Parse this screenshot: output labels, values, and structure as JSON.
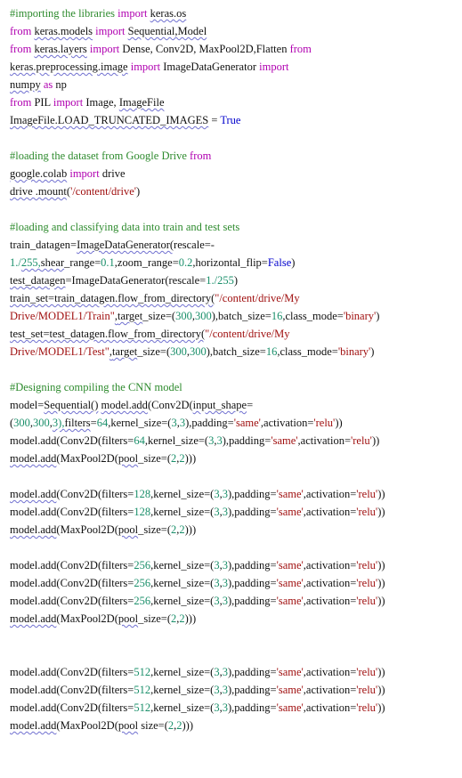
{
  "code_lines": [
    [
      {
        "t": "#importing the libraries ",
        "c": "c"
      },
      {
        "t": "import",
        "c": "k"
      },
      {
        "t": " "
      },
      {
        "t": "keras.os",
        "u": true
      }
    ],
    [
      {
        "t": "from",
        "c": "k"
      },
      {
        "t": " "
      },
      {
        "t": "keras.models",
        "u": true
      },
      {
        "t": " "
      },
      {
        "t": "import",
        "c": "k"
      },
      {
        "t": " "
      },
      {
        "t": "Sequential,Model",
        "u": true
      }
    ],
    [
      {
        "t": "from",
        "c": "k"
      },
      {
        "t": " "
      },
      {
        "t": "keras.layers",
        "u": true
      },
      {
        "t": " "
      },
      {
        "t": "import",
        "c": "k"
      },
      {
        "t": " Dense, Conv2D, MaxPool2D,Flatten "
      },
      {
        "t": "from",
        "c": "k"
      }
    ],
    [
      {
        "t": "keras.preprocessing.image",
        "u": true
      },
      {
        "t": " "
      },
      {
        "t": "import",
        "c": "k"
      },
      {
        "t": " ImageDataGenerator "
      },
      {
        "t": "import",
        "c": "k"
      }
    ],
    [
      {
        "t": "numpy",
        "u": true
      },
      {
        "t": " "
      },
      {
        "t": "as",
        "c": "k"
      },
      {
        "t": " np"
      }
    ],
    [
      {
        "t": "from",
        "c": "k"
      },
      {
        "t": " PIL "
      },
      {
        "t": "import",
        "c": "k"
      },
      {
        "t": " Image, "
      },
      {
        "t": "ImageFile",
        "u": true
      }
    ],
    [
      {
        "t": "ImageFile.LOAD_TRUNCATED_IMAGES",
        "u": true
      },
      {
        "t": " = "
      },
      {
        "t": "True",
        "c": "b"
      }
    ],
    null,
    [
      {
        "t": "#loading the dataset from Google Drive ",
        "c": "c"
      },
      {
        "t": "from",
        "c": "k"
      }
    ],
    [
      {
        "t": "google.colab",
        "u": true
      },
      {
        "t": " "
      },
      {
        "t": "import",
        "c": "k"
      },
      {
        "t": " drive"
      }
    ],
    [
      {
        "t": "drive .mount",
        "u": true
      },
      {
        "t": "("
      },
      {
        "t": "'/content/drive'",
        "c": "s"
      },
      {
        "t": ")"
      }
    ],
    null,
    [
      {
        "t": "#loading and classifying data into train and test sets",
        "c": "c"
      }
    ],
    [
      {
        "t": "train_datagen="
      },
      {
        "t": "ImageDataGenerator(",
        "u": true
      },
      {
        "t": "rescale=-"
      }
    ],
    [
      {
        "t": "1./",
        "c": "n"
      },
      {
        "t": "255,",
        "c": "n",
        "u": true
      },
      {
        "t": "shear",
        "u": true
      },
      {
        "t": "_range="
      },
      {
        "t": "0.1",
        "c": "n"
      },
      {
        "t": ",zoom_range="
      },
      {
        "t": "0.2",
        "c": "n"
      },
      {
        "t": ",horizontal_flip="
      },
      {
        "t": "False",
        "c": "b"
      },
      {
        "t": ")"
      }
    ],
    [
      {
        "t": "test_datagen",
        "u": true
      },
      {
        "t": "=ImageDataGenerator(rescale="
      },
      {
        "t": "1./255",
        "c": "n"
      },
      {
        "t": ")"
      }
    ],
    [
      {
        "t": "train_set=train_datagen.flow_from_directory(",
        "u": true
      },
      {
        "t": "\"/content/drive/My",
        "c": "s"
      }
    ],
    [
      {
        "t": "Drive/MODEL1/Train\"",
        "c": "s"
      },
      {
        "t": ",",
        "u": true
      },
      {
        "t": "target",
        "u": true
      },
      {
        "t": "_size=("
      },
      {
        "t": "300",
        "c": "n"
      },
      {
        "t": ","
      },
      {
        "t": "300",
        "c": "n"
      },
      {
        "t": "),batch_size="
      },
      {
        "t": "16",
        "c": "n"
      },
      {
        "t": ",class_mode="
      },
      {
        "t": "'binary'",
        "c": "s"
      },
      {
        "t": ")"
      }
    ],
    [
      {
        "t": "test_set=test_datagen.flow_from_directory(",
        "u": true
      },
      {
        "t": "\"/content/drive/My",
        "c": "s"
      }
    ],
    [
      {
        "t": "Drive/MODEL1/Test\"",
        "c": "s"
      },
      {
        "t": ",",
        "u": true
      },
      {
        "t": "target",
        "u": true
      },
      {
        "t": "_size=("
      },
      {
        "t": "300",
        "c": "n"
      },
      {
        "t": ","
      },
      {
        "t": "300",
        "c": "n"
      },
      {
        "t": "),batch_size="
      },
      {
        "t": "16",
        "c": "n"
      },
      {
        "t": ",class_mode="
      },
      {
        "t": "'binary'",
        "c": "s"
      },
      {
        "t": ")"
      }
    ],
    null,
    [
      {
        "t": "#Designing compiling the CNN model",
        "c": "c"
      }
    ],
    [
      {
        "t": "model="
      },
      {
        "t": "Sequential()",
        "u": true
      },
      {
        "t": " "
      },
      {
        "t": "model.add",
        "u": true
      },
      {
        "t": "(Conv2D("
      },
      {
        "t": "input_shape",
        "u": true
      },
      {
        "t": "="
      }
    ],
    [
      {
        "t": "("
      },
      {
        "t": "300",
        "c": "n"
      },
      {
        "t": ","
      },
      {
        "t": "300",
        "c": "n"
      },
      {
        "t": ","
      },
      {
        "t": "3),",
        "c": "n",
        "u": true
      },
      {
        "t": "filters",
        "u": true
      },
      {
        "t": "="
      },
      {
        "t": "64",
        "c": "n"
      },
      {
        "t": ",kernel_size=("
      },
      {
        "t": "3",
        "c": "n"
      },
      {
        "t": ","
      },
      {
        "t": "3",
        "c": "n"
      },
      {
        "t": "),padding="
      },
      {
        "t": "'same'",
        "c": "s"
      },
      {
        "t": ",activation="
      },
      {
        "t": "'relu'",
        "c": "s"
      },
      {
        "t": "))"
      }
    ],
    [
      {
        "t": "model.add(Conv2D(filters="
      },
      {
        "t": "64",
        "c": "n"
      },
      {
        "t": ",kernel_size=("
      },
      {
        "t": "3",
        "c": "n"
      },
      {
        "t": ","
      },
      {
        "t": "3",
        "c": "n"
      },
      {
        "t": "),padding="
      },
      {
        "t": "'same'",
        "c": "s"
      },
      {
        "t": ",activation="
      },
      {
        "t": "'relu'",
        "c": "s"
      },
      {
        "t": "))"
      }
    ],
    [
      {
        "t": "model.add",
        "u": true
      },
      {
        "t": "(MaxPool2D("
      },
      {
        "t": "pool",
        "u": true
      },
      {
        "t": "_size=("
      },
      {
        "t": "2",
        "c": "n"
      },
      {
        "t": ","
      },
      {
        "t": "2",
        "c": "n"
      },
      {
        "t": ")))"
      }
    ],
    null,
    [
      {
        "t": "model.add",
        "u": true
      },
      {
        "t": "(Conv2D(filters="
      },
      {
        "t": "128",
        "c": "n"
      },
      {
        "t": ",kernel_size=("
      },
      {
        "t": "3",
        "c": "n"
      },
      {
        "t": ","
      },
      {
        "t": "3",
        "c": "n"
      },
      {
        "t": "),padding="
      },
      {
        "t": "'same'",
        "c": "s"
      },
      {
        "t": ",activation="
      },
      {
        "t": "'relu'",
        "c": "s"
      },
      {
        "t": "))"
      }
    ],
    [
      {
        "t": "model.add(Conv2D(filters="
      },
      {
        "t": "128",
        "c": "n"
      },
      {
        "t": ",kernel_size=("
      },
      {
        "t": "3",
        "c": "n"
      },
      {
        "t": ","
      },
      {
        "t": "3",
        "c": "n"
      },
      {
        "t": "),padding="
      },
      {
        "t": "'same'",
        "c": "s"
      },
      {
        "t": ",activation="
      },
      {
        "t": "'relu'",
        "c": "s"
      },
      {
        "t": "))"
      }
    ],
    [
      {
        "t": "model.add",
        "u": true
      },
      {
        "t": "(MaxPool2D("
      },
      {
        "t": "pool",
        "u": true
      },
      {
        "t": "_size=("
      },
      {
        "t": "2",
        "c": "n"
      },
      {
        "t": ","
      },
      {
        "t": "2",
        "c": "n"
      },
      {
        "t": ")))"
      }
    ],
    null,
    [
      {
        "t": "model.add(Conv2D(filters="
      },
      {
        "t": "256",
        "c": "n"
      },
      {
        "t": ",kernel_size=("
      },
      {
        "t": "3",
        "c": "n"
      },
      {
        "t": ","
      },
      {
        "t": "3",
        "c": "n"
      },
      {
        "t": "),padding="
      },
      {
        "t": "'same'",
        "c": "s"
      },
      {
        "t": ",activation="
      },
      {
        "t": "'relu'",
        "c": "s"
      },
      {
        "t": "))"
      }
    ],
    [
      {
        "t": "model.add(Conv2D(filters="
      },
      {
        "t": "256",
        "c": "n"
      },
      {
        "t": ",kernel_size=("
      },
      {
        "t": "3",
        "c": "n"
      },
      {
        "t": ","
      },
      {
        "t": "3",
        "c": "n"
      },
      {
        "t": "),padding="
      },
      {
        "t": "'same'",
        "c": "s"
      },
      {
        "t": ",activation="
      },
      {
        "t": "'relu'",
        "c": "s"
      },
      {
        "t": "))"
      }
    ],
    [
      {
        "t": "model.add(Conv2D(filters="
      },
      {
        "t": "256",
        "c": "n"
      },
      {
        "t": ",kernel_size=("
      },
      {
        "t": "3",
        "c": "n"
      },
      {
        "t": ","
      },
      {
        "t": "3",
        "c": "n"
      },
      {
        "t": "),padding="
      },
      {
        "t": "'same'",
        "c": "s"
      },
      {
        "t": ",activation="
      },
      {
        "t": "'relu'",
        "c": "s"
      },
      {
        "t": "))"
      }
    ],
    [
      {
        "t": "model.add",
        "u": true
      },
      {
        "t": "(MaxPool2D("
      },
      {
        "t": "pool",
        "u": true
      },
      {
        "t": "_size=("
      },
      {
        "t": "2",
        "c": "n"
      },
      {
        "t": ","
      },
      {
        "t": "2",
        "c": "n"
      },
      {
        "t": ")))"
      }
    ],
    "gap2",
    [
      {
        "t": "model.add(Conv2D(filters="
      },
      {
        "t": "512",
        "c": "n"
      },
      {
        "t": ",kernel_size=("
      },
      {
        "t": "3",
        "c": "n"
      },
      {
        "t": ","
      },
      {
        "t": "3",
        "c": "n"
      },
      {
        "t": "),padding="
      },
      {
        "t": "'same'",
        "c": "s"
      },
      {
        "t": ",activation="
      },
      {
        "t": "'relu'",
        "c": "s"
      },
      {
        "t": "))"
      }
    ],
    [
      {
        "t": "model.add(Conv2D(filters="
      },
      {
        "t": "512",
        "c": "n"
      },
      {
        "t": ",kernel_size=("
      },
      {
        "t": "3",
        "c": "n"
      },
      {
        "t": ","
      },
      {
        "t": "3",
        "c": "n"
      },
      {
        "t": "),padding="
      },
      {
        "t": "'same'",
        "c": "s"
      },
      {
        "t": ",activation="
      },
      {
        "t": "'relu'",
        "c": "s"
      },
      {
        "t": "))"
      }
    ],
    [
      {
        "t": "model.add(Conv2D(filters="
      },
      {
        "t": "512",
        "c": "n"
      },
      {
        "t": ",kernel_size=("
      },
      {
        "t": "3",
        "c": "n"
      },
      {
        "t": ","
      },
      {
        "t": "3",
        "c": "n"
      },
      {
        "t": "),padding="
      },
      {
        "t": "'same'",
        "c": "s"
      },
      {
        "t": ",activation="
      },
      {
        "t": "'relu'",
        "c": "s"
      },
      {
        "t": "))"
      }
    ],
    [
      {
        "t": "model.add",
        "u": true
      },
      {
        "t": "(MaxPool2D("
      },
      {
        "t": "pool",
        "u": true
      },
      {
        "t": " size=("
      },
      {
        "t": "2",
        "c": "n"
      },
      {
        "t": ","
      },
      {
        "t": "2",
        "c": "n"
      },
      {
        "t": ")))"
      }
    ]
  ],
  "colors": {
    "comment": "#2e8b2e",
    "keyword": "#b000b0",
    "string": "#a01010",
    "number": "#1a8f6a",
    "boolean": "#0000cc",
    "text": "#111111",
    "spellcheck_underline": "#7070d0"
  }
}
